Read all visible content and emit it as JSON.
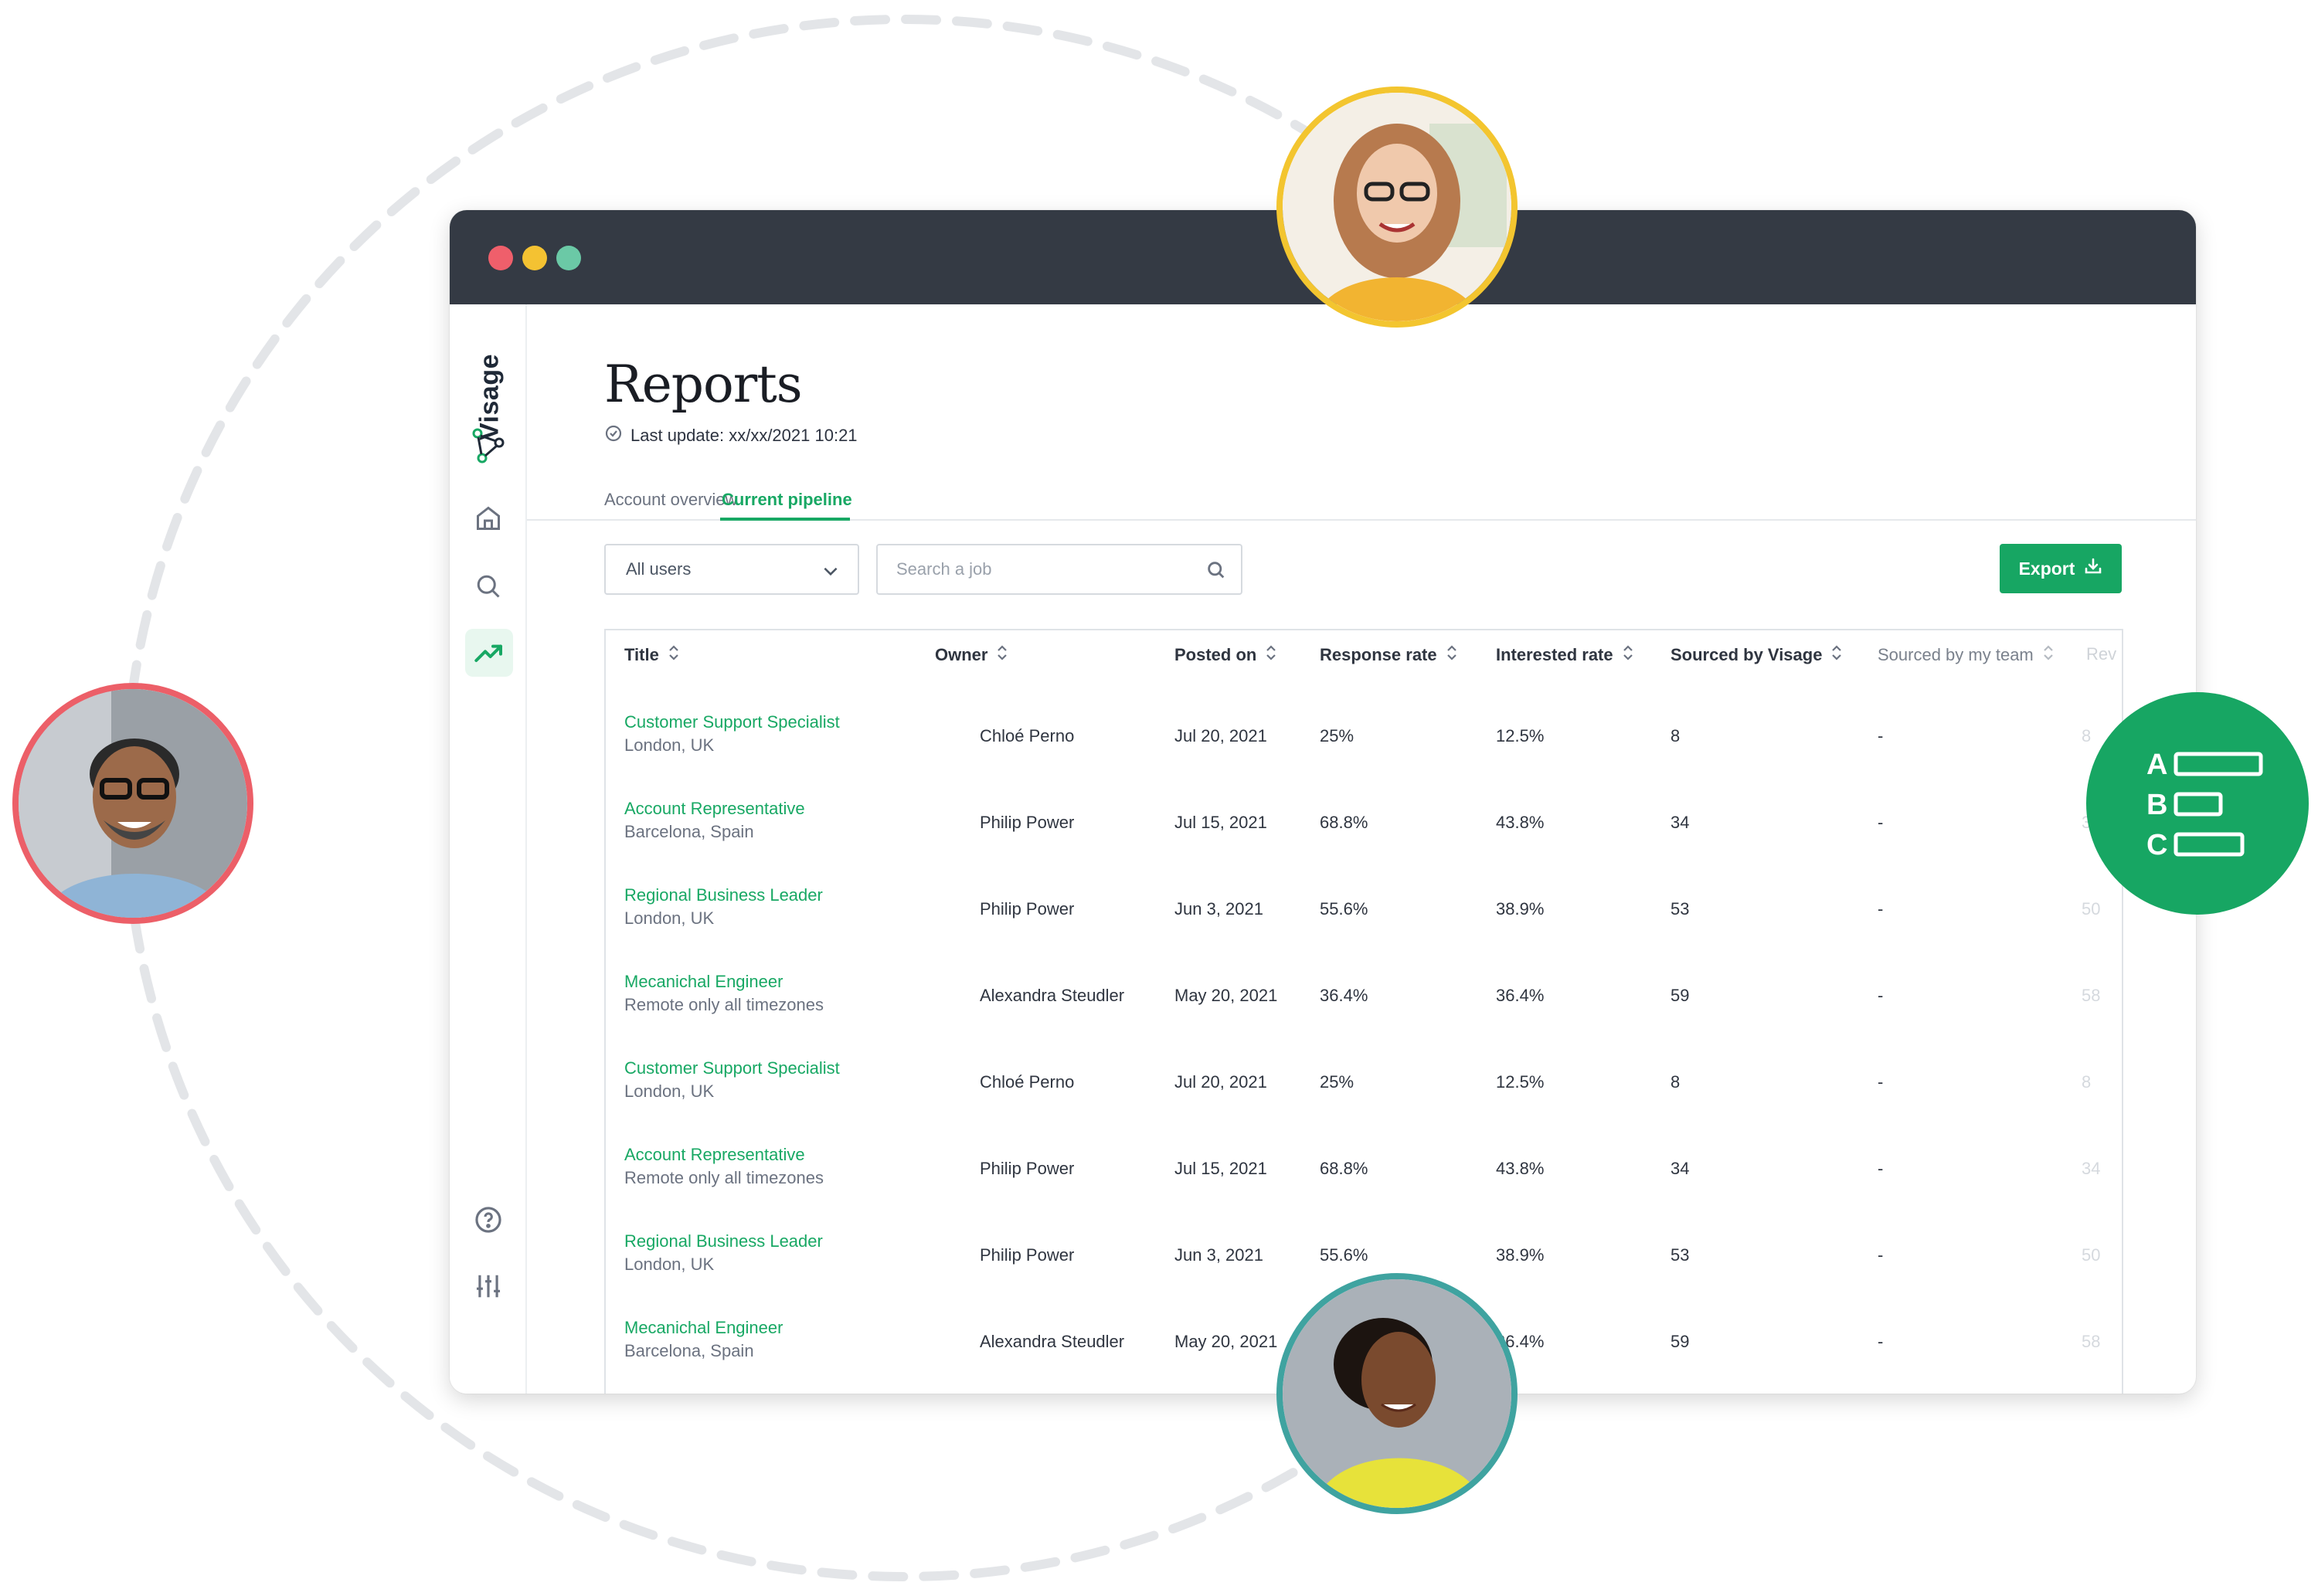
{
  "app": {
    "name": "Visage"
  },
  "page": {
    "title": "Reports",
    "last_update": "Last update: xx/xx/2021 10:21"
  },
  "tabs": [
    {
      "label": "Account overview",
      "active": false
    },
    {
      "label": "Current pipeline",
      "active": true
    }
  ],
  "filters": {
    "users_select": {
      "value": "All users"
    },
    "search": {
      "placeholder": "Search a job"
    },
    "export_label": "Export"
  },
  "table": {
    "columns": [
      "Title",
      "Owner",
      "Posted on",
      "Response rate",
      "Interested rate",
      "Sourced by Visage",
      "Sourced by my team",
      "Rev"
    ],
    "rows": [
      {
        "title": "Customer Support Specialist",
        "location": "London, UK",
        "owner": "Chloé Perno",
        "posted": "Jul 20, 2021",
        "response": "25%",
        "interested": "12.5%",
        "visage": "8",
        "team": "-",
        "rev": "8"
      },
      {
        "title": "Account Representative",
        "location": "Barcelona, Spain",
        "owner": "Philip Power",
        "posted": "Jul 15, 2021",
        "response": "68.8%",
        "interested": "43.8%",
        "visage": "34",
        "team": "-",
        "rev": "34"
      },
      {
        "title": "Regional Business Leader",
        "location": "London, UK",
        "owner": "Philip Power",
        "posted": "Jun 3, 2021",
        "response": "55.6%",
        "interested": "38.9%",
        "visage": "53",
        "team": "-",
        "rev": "50"
      },
      {
        "title": "Mecanichal Engineer",
        "location": "Remote only all timezones",
        "owner": "Alexandra Steudler",
        "posted": "May 20, 2021",
        "response": "36.4%",
        "interested": "36.4%",
        "visage": "59",
        "team": "-",
        "rev": "58"
      },
      {
        "title": "Customer Support Specialist",
        "location": "London, UK",
        "owner": "Chloé Perno",
        "posted": "Jul 20, 2021",
        "response": "25%",
        "interested": "12.5%",
        "visage": "8",
        "team": "-",
        "rev": "8"
      },
      {
        "title": "Account Representative",
        "location": "Remote only all timezones",
        "owner": "Philip Power",
        "posted": "Jul 15, 2021",
        "response": "68.8%",
        "interested": "43.8%",
        "visage": "34",
        "team": "-",
        "rev": "34"
      },
      {
        "title": "Regional Business Leader",
        "location": "London, UK",
        "owner": "Philip Power",
        "posted": "Jun 3, 2021",
        "response": "55.6%",
        "interested": "38.9%",
        "visage": "53",
        "team": "-",
        "rev": "50"
      },
      {
        "title": "Mecanichal Engineer",
        "location": "Barcelona, Spain",
        "owner": "Alexandra Steudler",
        "posted": "May 20, 2021",
        "response": "",
        "interested": "36.4%",
        "visage": "59",
        "team": "-",
        "rev": "58"
      }
    ]
  },
  "badge": {
    "letters": [
      "A",
      "B",
      "C"
    ]
  },
  "colors": {
    "brand_green": "#17a663",
    "titlebar": "#343a44",
    "ring_yellow": "#f3c52f",
    "ring_red": "#ec5f68",
    "ring_teal": "#3fa3a0"
  },
  "icons": [
    "home-icon",
    "search-icon",
    "trending-icon",
    "help-icon",
    "sliders-icon",
    "chevron-down-icon",
    "magnifier-icon",
    "download-icon",
    "sort-icon",
    "check-circle-icon"
  ]
}
